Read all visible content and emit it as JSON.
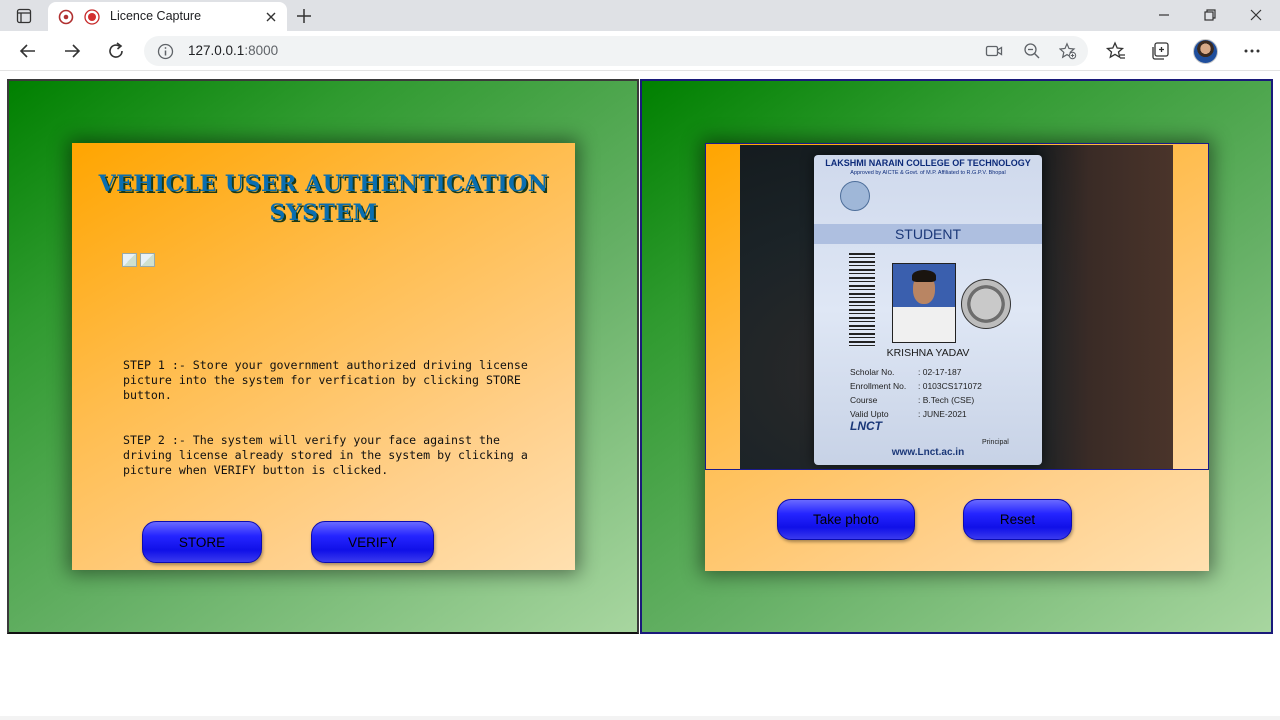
{
  "browser": {
    "tab_title": "Licence Capture",
    "url_host": "127.0.0.1",
    "url_port": ":8000"
  },
  "left_card": {
    "heading": "VEHICLE USER AUTHENTICATION SYSTEM",
    "step1": "STEP 1 :- Store your government authorized driving license picture into the system for verfication by clicking STORE button.",
    "step2": "STEP 2 :- The system will verify your face against the driving license already stored in the system by clicking a picture when VERIFY button is clicked.",
    "store_label": "STORE",
    "verify_label": "VERIFY"
  },
  "right_card": {
    "take_label": "Take photo",
    "reset_label": "Reset",
    "camera_feed": {
      "college": "LAKSHMI NARAIN COLLEGE OF TECHNOLOGY",
      "approved": "Approved by AICTE & Govt. of M.P. Affiliated to R.G.P.V. Bhopal",
      "role": "STUDENT",
      "name": "KRISHNA YADAV",
      "rows": [
        {
          "label": "Scholar No.",
          "value": ": 02-17-187"
        },
        {
          "label": "Enrollment No.",
          "value": ": 0103CS171072"
        },
        {
          "label": "Course",
          "value": ": B.Tech (CSE)"
        },
        {
          "label": "Valid Upto",
          "value": ": JUNE-2021"
        }
      ],
      "brand": "LNCT",
      "principal": "Principal",
      "site": "www.Lnct.ac.in"
    }
  },
  "colors": {
    "panel_green": "#008000",
    "card_orange": "#ffa500",
    "button_blue": "#1010e8"
  }
}
